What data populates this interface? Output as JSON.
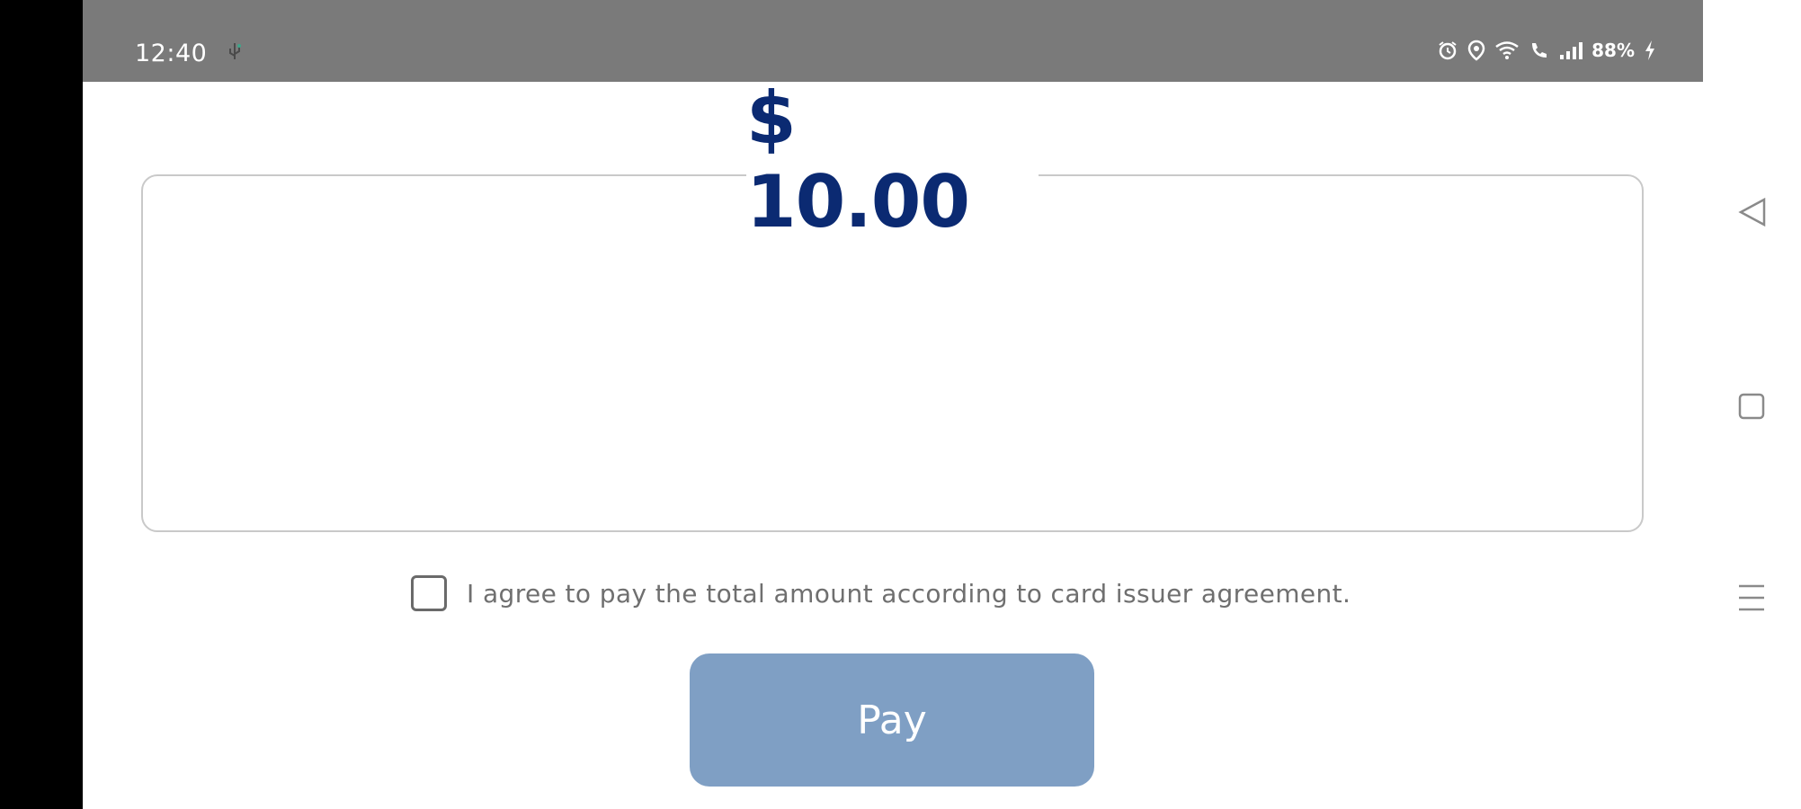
{
  "status_bar": {
    "time": "12:40",
    "battery": "88%"
  },
  "payment": {
    "amount": "$ 10.00",
    "agreement_text": "I agree to pay the total amount according to card issuer agreement.",
    "pay_label": "Pay"
  },
  "icons": {
    "notification": "usb-icon",
    "alarm": "alarm-icon",
    "location": "location-icon",
    "wifi": "wifi-icon",
    "call": "wifi-call-icon",
    "signal": "signal-icon",
    "charging": "charging-icon",
    "nav_back": "back-icon",
    "nav_home": "home-icon",
    "nav_menu": "menu-icon"
  },
  "colors": {
    "amount": "#0b2a72",
    "pay_button": "#7f9fc4",
    "status_bar": "#7a7a7a"
  }
}
